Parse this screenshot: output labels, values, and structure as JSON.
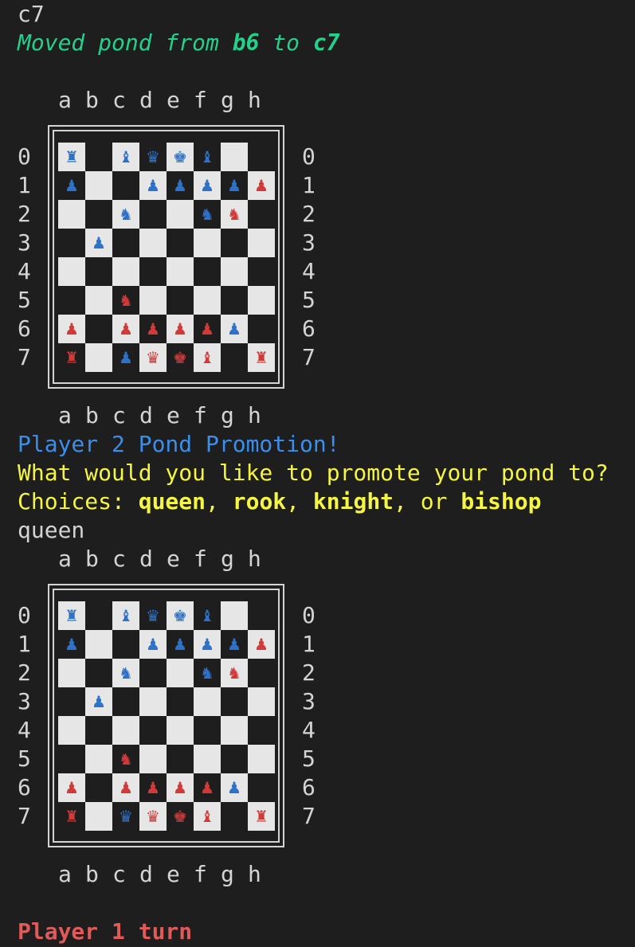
{
  "log": {
    "input_move": "c7",
    "moved_prefix": "Moved pond from ",
    "moved_from": "b6",
    "moved_mid": " to ",
    "moved_to": "c7",
    "promotion_title": "Player 2 Pond Promotion!",
    "promotion_question": "What would you like to promote your pond to?",
    "choices_prefix": "Choices: ",
    "choice_queen": "queen",
    "sep1": ", ",
    "choice_rook": "rook",
    "sep2": ", ",
    "choice_knight": "knight",
    "sep3": ", or ",
    "choice_bishop": "bishop",
    "input_promotion": "queen",
    "turn": "Player 1 turn"
  },
  "files": [
    "a",
    "b",
    "c",
    "d",
    "e",
    "f",
    "g",
    "h"
  ],
  "ranks": [
    "0",
    "1",
    "2",
    "3",
    "4",
    "5",
    "6",
    "7"
  ],
  "colors": {
    "player_blue": "#2d72c8",
    "player_red": "#d23a3a",
    "light_square": "#e6e6e6",
    "dark_square": "#1e1e1e"
  },
  "piece_glyphs": {
    "R": "♜",
    "N": "♞",
    "B": "♝",
    "Q": "♛",
    "K": "♚",
    "P": "♟"
  },
  "boards": [
    {
      "rows": [
        [
          "bR",
          "",
          "bB",
          "bQ",
          "bK",
          "bB",
          "",
          ""
        ],
        [
          "bP",
          "",
          "",
          "bP",
          "bP",
          "bP",
          "bP",
          "rP"
        ],
        [
          "",
          "",
          "bN",
          "",
          "",
          "bN",
          "rN",
          ""
        ],
        [
          "",
          "bP",
          "",
          "",
          "",
          "",
          "",
          ""
        ],
        [
          "",
          "",
          "",
          "",
          "",
          "",
          "",
          ""
        ],
        [
          "",
          "",
          "rN",
          "",
          "",
          "",
          "",
          ""
        ],
        [
          "rP",
          "",
          "rP",
          "rP",
          "rP",
          "rP",
          "bP",
          ""
        ],
        [
          "rR",
          "",
          "bP",
          "rQ",
          "rK",
          "rB",
          "",
          "rR"
        ]
      ]
    },
    {
      "rows": [
        [
          "bR",
          "",
          "bB",
          "bQ",
          "bK",
          "bB",
          "",
          ""
        ],
        [
          "bP",
          "",
          "",
          "bP",
          "bP",
          "bP",
          "bP",
          "rP"
        ],
        [
          "",
          "",
          "bN",
          "",
          "",
          "bN",
          "rN",
          ""
        ],
        [
          "",
          "bP",
          "",
          "",
          "",
          "",
          "",
          ""
        ],
        [
          "",
          "",
          "",
          "",
          "",
          "",
          "",
          ""
        ],
        [
          "",
          "",
          "rN",
          "",
          "",
          "",
          "",
          ""
        ],
        [
          "rP",
          "",
          "rP",
          "rP",
          "rP",
          "rP",
          "bP",
          ""
        ],
        [
          "rR",
          "",
          "bQ",
          "rQ",
          "rK",
          "rB",
          "",
          "rR"
        ]
      ]
    }
  ]
}
